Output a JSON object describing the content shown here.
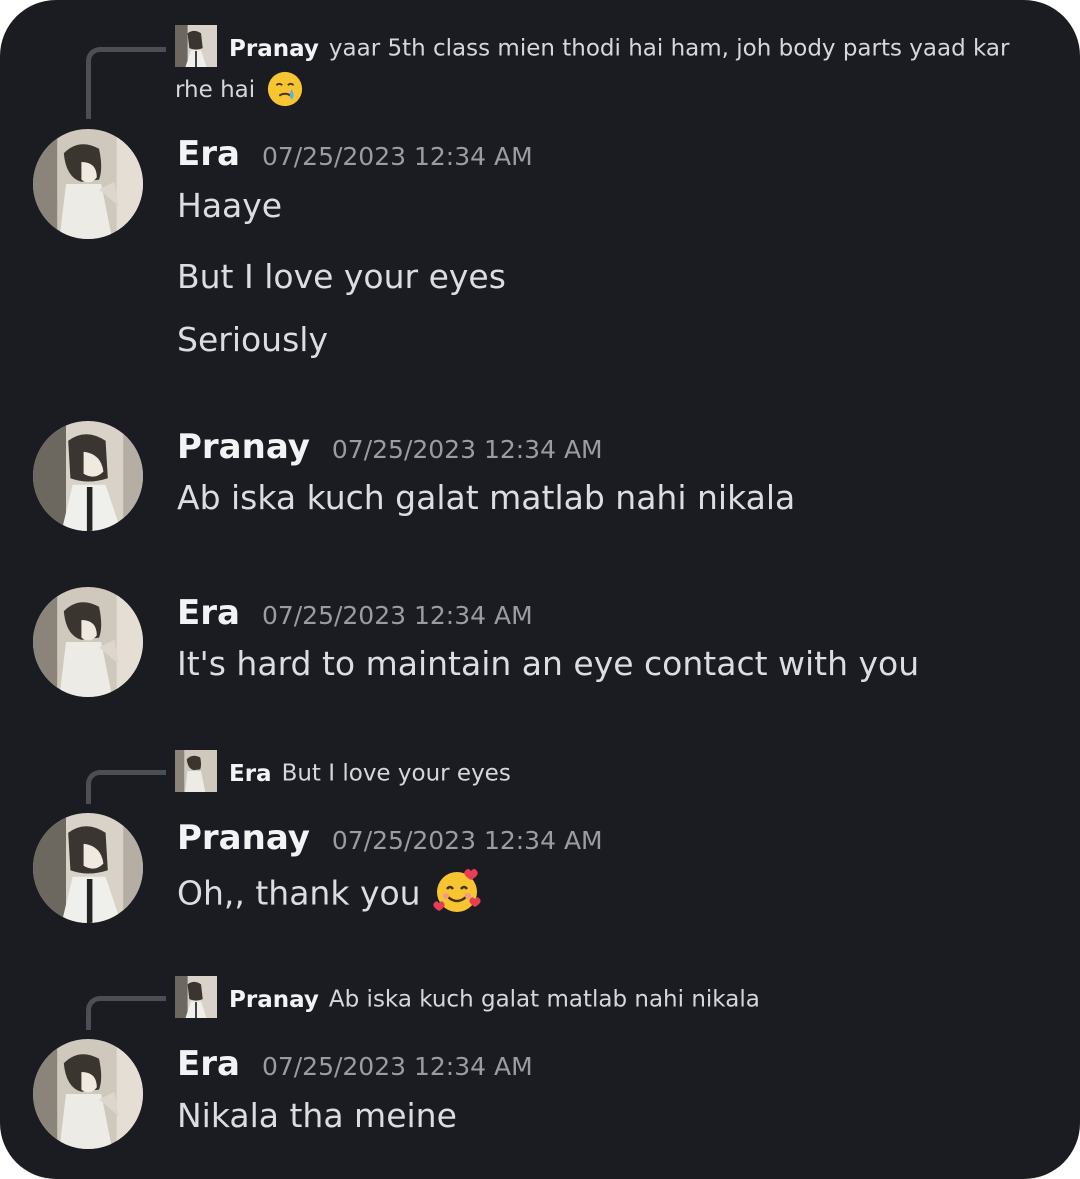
{
  "messages": [
    {
      "reply_to": {
        "name": "Pranay",
        "text": "yaar 5th class mien thodi hai ham, joh body parts yaad kar rhe hai",
        "emoji": "crying-face-emoji"
      },
      "author": "Era",
      "time": "07/25/2023 12:34 AM",
      "lines": [
        "Haaye",
        "But I love your eyes",
        "Seriously"
      ]
    },
    {
      "author": "Pranay",
      "time": "07/25/2023 12:34 AM",
      "lines": [
        "Ab iska kuch galat matlab nahi nikala"
      ]
    },
    {
      "author": "Era",
      "time": "07/25/2023 12:34 AM",
      "lines": [
        "It's hard to maintain an eye contact with you"
      ]
    },
    {
      "reply_to": {
        "name": "Era",
        "text": "But I love your eyes"
      },
      "author": "Pranay",
      "time": "07/25/2023 12:34 AM",
      "lines": [
        "Oh,, thank you"
      ],
      "emoji": "smiling-face-with-hearts-emoji"
    },
    {
      "reply_to": {
        "name": "Pranay",
        "text": "Ab iska kuch galat matlab nahi nikala"
      },
      "author": "Era",
      "time": "07/25/2023 12:34 AM",
      "lines": [
        "Nikala tha meine"
      ]
    }
  ],
  "colors": {
    "background": "#1b1c21",
    "name": "#f2f3f5",
    "text": "#dcdde1",
    "timestamp": "#9a9ca4",
    "reply_line": "#4c4e56"
  }
}
